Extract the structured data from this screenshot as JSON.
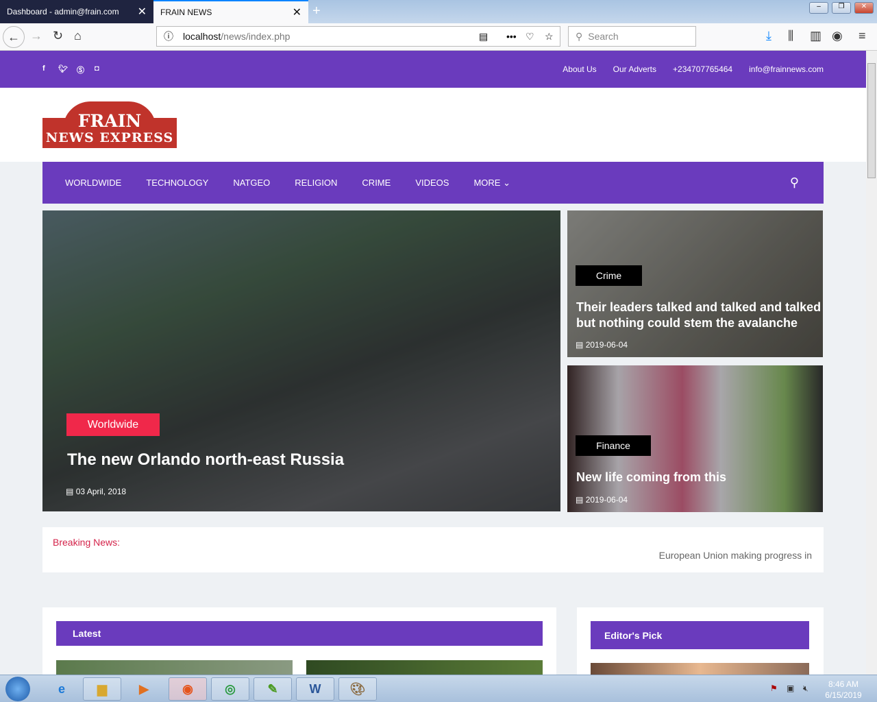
{
  "browser": {
    "tabs": [
      {
        "title": "Dashboard - admin@frain.com"
      },
      {
        "title": "FRAIN NEWS"
      }
    ],
    "url_host": "localhost",
    "url_path": "/news/index.php",
    "search_placeholder": "Search"
  },
  "topbar": {
    "social": [
      "f",
      "t",
      "s",
      "ig"
    ],
    "links": [
      "About Us",
      "Our Adverts",
      "+234707765464",
      "info@frainnews.com"
    ]
  },
  "logo": {
    "line1": "FRAIN",
    "line2": "NEWS EXPRESS"
  },
  "nav": {
    "items": [
      "WORLDWIDE",
      "TECHNOLOGY",
      "NATGEO",
      "RELIGION",
      "CRIME",
      "VIDEOS",
      "MORE"
    ]
  },
  "hero": {
    "main": {
      "category": "Worldwide",
      "title": "The new Orlando north-east Russia",
      "date": "03 April, 2018"
    },
    "side": [
      {
        "category": "Crime",
        "title": "Their leaders talked and talked and talked but nothing could stem the avalanche",
        "date": "2019-06-04"
      },
      {
        "category": "Finance",
        "title": "New life coming from this",
        "date": "2019-06-04"
      }
    ]
  },
  "breaking": {
    "label": "Breaking News:",
    "text": "European Union making progress in"
  },
  "sections": {
    "latest": "Latest",
    "editors": "Editor's Pick"
  },
  "taskbar": {
    "time": "8:46 AM",
    "date": "6/15/2019"
  },
  "colors": {
    "brand": "#6a3bbd",
    "accent": "#f0284a"
  }
}
